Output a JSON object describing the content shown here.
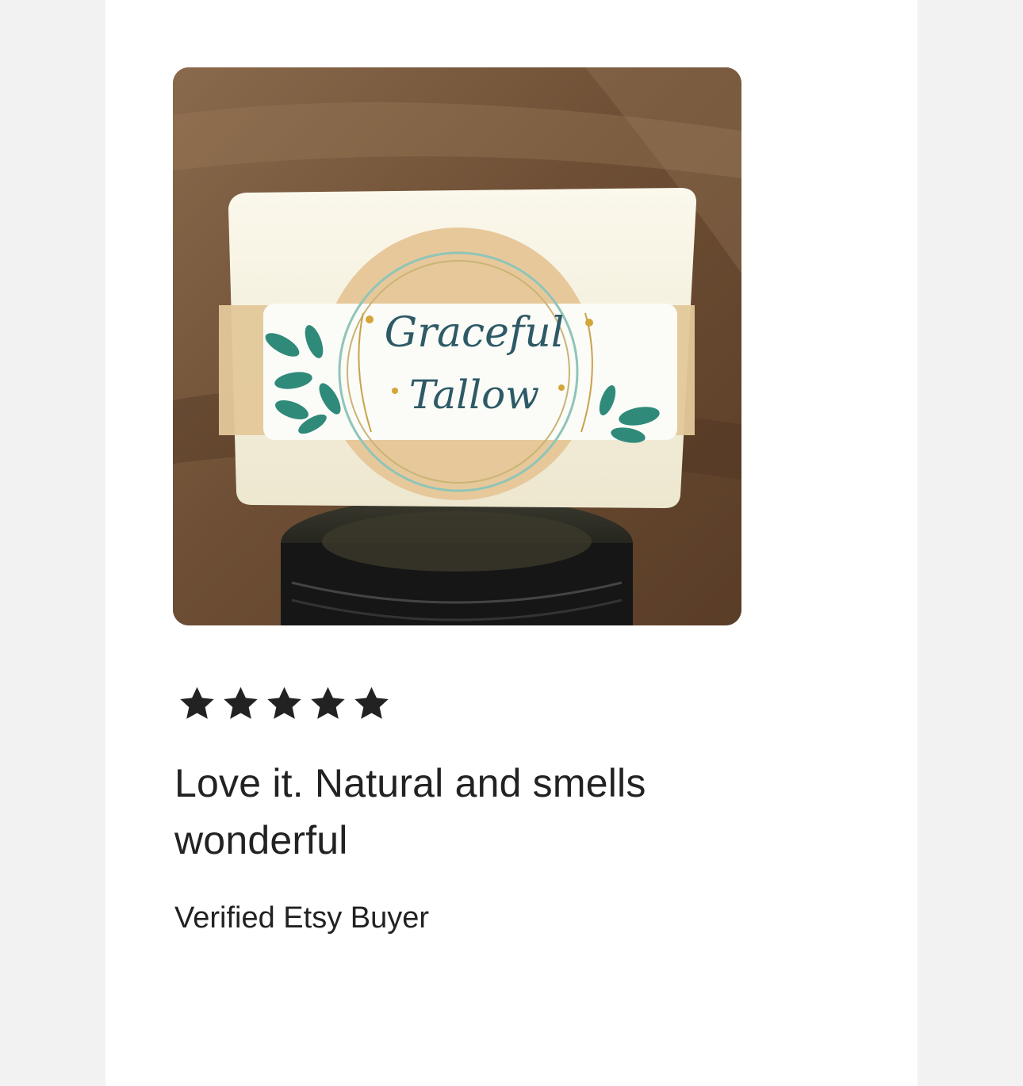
{
  "review": {
    "rating": 5,
    "rating_max": 5,
    "text": "Love it. Natural and smells wonderful",
    "reviewer": "Verified Etsy Buyer",
    "star_color": "#222222"
  },
  "photo": {
    "label_line1": "Graceful",
    "label_line2": "Tallow",
    "label_text_color": "#2d5a66",
    "leaf_color": "#2f8a7a"
  }
}
